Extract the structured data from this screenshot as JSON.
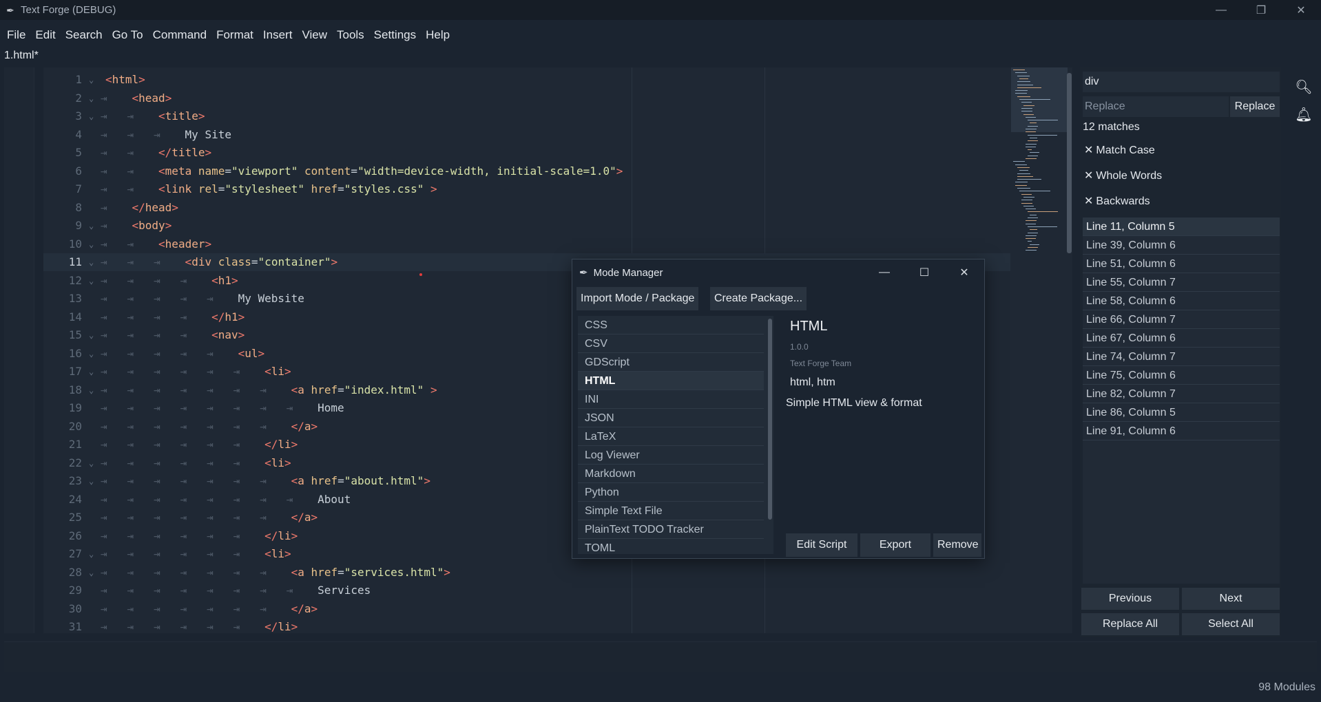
{
  "window": {
    "title": "Text Forge (DEBUG)",
    "minimize": "—",
    "maximize": "❐",
    "close": "✕"
  },
  "menu": [
    "File",
    "Edit",
    "Search",
    "Go To",
    "Command",
    "Format",
    "Insert",
    "View",
    "Tools",
    "Settings",
    "Help"
  ],
  "tab": {
    "label": "1.html*"
  },
  "editor": {
    "current_line": 11,
    "lines": [
      {
        "n": "1",
        "indent": 0,
        "fold": true,
        "html": "<span class='tag'>&lt;</span><span class='tagname'>html</span><span class='tag'>&gt;</span>"
      },
      {
        "n": "2",
        "indent": 1,
        "fold": true,
        "html": "<span class='tag'>&lt;</span><span class='tagname'>head</span><span class='tag'>&gt;</span>"
      },
      {
        "n": "3",
        "indent": 2,
        "fold": true,
        "html": "<span class='tag'>&lt;</span><span class='tagname'>title</span><span class='tag'>&gt;</span>"
      },
      {
        "n": "4",
        "indent": 3,
        "fold": false,
        "html": "My Site"
      },
      {
        "n": "5",
        "indent": 2,
        "fold": false,
        "html": "<span class='tag'>&lt;/</span><span class='tagname'>title</span><span class='tag'>&gt;</span>"
      },
      {
        "n": "6",
        "indent": 2,
        "fold": false,
        "html": "<span class='tag'>&lt;</span><span class='tagname'>meta</span> <span class='attr'>name</span>=<span class='str'>\"viewport\"</span> <span class='attr'>content</span>=<span class='str'>\"width=device-width, initial-scale=1.0\"</span><span class='tag'>&gt;</span>"
      },
      {
        "n": "7",
        "indent": 2,
        "fold": false,
        "html": "<span class='tag'>&lt;</span><span class='tagname'>link</span> <span class='attr'>rel</span>=<span class='str'>\"stylesheet\"</span> <span class='attr'>href</span>=<span class='str'>\"styles.css\"</span> <span class='tag'>&gt;</span>"
      },
      {
        "n": "8",
        "indent": 1,
        "fold": false,
        "html": "<span class='tag'>&lt;/</span><span class='tagname'>head</span><span class='tag'>&gt;</span>"
      },
      {
        "n": "9",
        "indent": 1,
        "fold": true,
        "html": "<span class='tag'>&lt;</span><span class='tagname'>body</span><span class='tag'>&gt;</span>"
      },
      {
        "n": "10",
        "indent": 2,
        "fold": true,
        "html": "<span class='tag'>&lt;</span><span class='tagname'>header</span><span class='tag'>&gt;</span>"
      },
      {
        "n": "11",
        "indent": 3,
        "fold": true,
        "html": "<span class='tag'>&lt;</span><span class='tagname'>div</span> <span class='attr'>class</span>=<span class='str'>\"container\"</span><span class='tag'>&gt;</span>"
      },
      {
        "n": "12",
        "indent": 4,
        "fold": true,
        "html": "<span class='tag'>&lt;</span><span class='tagname'>h1</span><span class='tag'>&gt;</span>"
      },
      {
        "n": "13",
        "indent": 5,
        "fold": false,
        "html": "My Website"
      },
      {
        "n": "14",
        "indent": 4,
        "fold": false,
        "html": "<span class='tag'>&lt;/</span><span class='tagname'>h1</span><span class='tag'>&gt;</span>"
      },
      {
        "n": "15",
        "indent": 4,
        "fold": true,
        "html": "<span class='tag'>&lt;</span><span class='tagname'>nav</span><span class='tag'>&gt;</span>"
      },
      {
        "n": "16",
        "indent": 5,
        "fold": true,
        "html": "<span class='tag'>&lt;</span><span class='tagname'>ul</span><span class='tag'>&gt;</span>"
      },
      {
        "n": "17",
        "indent": 6,
        "fold": true,
        "html": "<span class='tag'>&lt;</span><span class='tagname'>li</span><span class='tag'>&gt;</span>"
      },
      {
        "n": "18",
        "indent": 7,
        "fold": true,
        "html": "<span class='tag'>&lt;</span><span class='tagname'>a</span> <span class='attr'>href</span>=<span class='str'>\"index.html\"</span> <span class='tag'>&gt;</span>"
      },
      {
        "n": "19",
        "indent": 8,
        "fold": false,
        "html": "Home"
      },
      {
        "n": "20",
        "indent": 7,
        "fold": false,
        "html": "<span class='tag'>&lt;/</span><span class='tagname'>a</span><span class='tag'>&gt;</span>"
      },
      {
        "n": "21",
        "indent": 6,
        "fold": false,
        "html": "<span class='tag'>&lt;/</span><span class='tagname'>li</span><span class='tag'>&gt;</span>"
      },
      {
        "n": "22",
        "indent": 6,
        "fold": true,
        "html": "<span class='tag'>&lt;</span><span class='tagname'>li</span><span class='tag'>&gt;</span>"
      },
      {
        "n": "23",
        "indent": 7,
        "fold": true,
        "html": "<span class='tag'>&lt;</span><span class='tagname'>a</span> <span class='attr'>href</span>=<span class='str'>\"about.html\"</span><span class='tag'>&gt;</span>"
      },
      {
        "n": "24",
        "indent": 8,
        "fold": false,
        "html": "About"
      },
      {
        "n": "25",
        "indent": 7,
        "fold": false,
        "html": "<span class='tag'>&lt;/</span><span class='tagname'>a</span><span class='tag'>&gt;</span>"
      },
      {
        "n": "26",
        "indent": 6,
        "fold": false,
        "html": "<span class='tag'>&lt;/</span><span class='tagname'>li</span><span class='tag'>&gt;</span>"
      },
      {
        "n": "27",
        "indent": 6,
        "fold": true,
        "html": "<span class='tag'>&lt;</span><span class='tagname'>li</span><span class='tag'>&gt;</span>"
      },
      {
        "n": "28",
        "indent": 7,
        "fold": true,
        "html": "<span class='tag'>&lt;</span><span class='tagname'>a</span> <span class='attr'>href</span>=<span class='str'>\"services.html\"</span><span class='tag'>&gt;</span>"
      },
      {
        "n": "29",
        "indent": 8,
        "fold": false,
        "html": "Services"
      },
      {
        "n": "30",
        "indent": 7,
        "fold": false,
        "html": "<span class='tag'>&lt;/</span><span class='tagname'>a</span><span class='tag'>&gt;</span>"
      },
      {
        "n": "31",
        "indent": 6,
        "fold": false,
        "html": "<span class='tag'>&lt;/</span><span class='tagname'>li</span><span class='tag'>&gt;</span>"
      }
    ]
  },
  "search": {
    "query": "div",
    "replace_placeholder": "Replace",
    "replace_button": "Replace",
    "matches": "12 matches",
    "options": [
      {
        "label": "Match Case",
        "mark": "✕"
      },
      {
        "label": "Whole Words",
        "mark": "✕"
      },
      {
        "label": "Backwards",
        "mark": "✕"
      }
    ],
    "results": [
      "Line 11, Column 5",
      "Line 39, Column 6",
      "Line 51, Column 6",
      "Line 55, Column 7",
      "Line 58, Column 6",
      "Line 66, Column 7",
      "Line 67, Column 6",
      "Line 74, Column 7",
      "Line 75, Column 6",
      "Line 82, Column 7",
      "Line 86, Column 5",
      "Line 91, Column 6"
    ],
    "previous": "Previous",
    "next": "Next",
    "replace_all": "Replace All",
    "select_all": "Select All"
  },
  "mode_manager": {
    "title": "Mode Manager",
    "import_button": "Import Mode / Package",
    "create_button": "Create Package...",
    "modes": [
      "CSS",
      "CSV",
      "GDScript",
      "HTML",
      "INI",
      "JSON",
      "LaTeX",
      "Log Viewer",
      "Markdown",
      "Python",
      "Simple Text File",
      "PlainText TODO Tracker",
      "TOML"
    ],
    "selected_mode": "HTML",
    "detail": {
      "name": "HTML",
      "version": "1.0.0",
      "author": "Text Forge Team",
      "extensions": "html, htm",
      "description": "Simple HTML view & format"
    },
    "edit_script": "Edit Script",
    "export": "Export",
    "remove": "Remove"
  },
  "status": {
    "modules": "98 Modules"
  }
}
